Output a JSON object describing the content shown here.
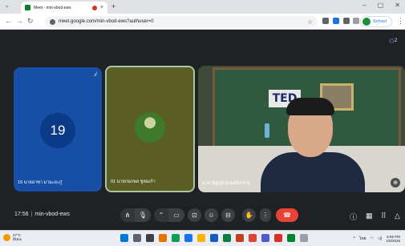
{
  "browser": {
    "tab_title": "Meet - min-vbod-ews",
    "tab_close": "×",
    "new_tab": "+",
    "url": "meet.google.com/min-vbod-ews?authuser=0",
    "profile_name": "School",
    "window_controls": [
      "–",
      "▢",
      "✕"
    ]
  },
  "meet": {
    "participant_count": "2",
    "tiles": [
      {
        "avatar_letter": "19",
        "name": "19 นายอาซา มามะยะกู๋"
      },
      {
        "name": "01 นายกนกพล ชูลมเก้า"
      },
      {
        "sign_text": "TED",
        "name": "นาย ณัฐภูมิ ศุภผลนิลชาน"
      }
    ],
    "meeting_time": "17:56",
    "meeting_code": "min-vbod-ews",
    "icons": {
      "people": "people-icon",
      "mic_off": "mic-off-icon",
      "pin": "pin-icon"
    }
  },
  "controls": {
    "buttons": [
      {
        "name": "audio-options-button",
        "glyph": "⋔"
      },
      {
        "name": "mic-button",
        "glyph": "🎙"
      },
      {
        "name": "video-options-button",
        "glyph": "⌃"
      },
      {
        "name": "camera-button",
        "glyph": "▭"
      },
      {
        "name": "present-button",
        "glyph": "⊡"
      },
      {
        "name": "emoji-button",
        "glyph": "☺"
      },
      {
        "name": "captions-button",
        "glyph": "⊟"
      },
      {
        "name": "raise-hand-button",
        "glyph": "✋"
      },
      {
        "name": "more-options-button",
        "glyph": "⋮"
      },
      {
        "name": "leave-call-button",
        "glyph": "☎"
      }
    ],
    "right": [
      "ⓘ",
      "▦",
      "⠿",
      "△"
    ]
  },
  "taskbar": {
    "weather_temp": "27°C",
    "weather_text": "มีเมฆ",
    "clock_time": "5:55 PM",
    "clock_date": "1/5/2026",
    "lang": "ไทย"
  },
  "colors": {
    "meet_bg": "#202124",
    "tile1_bg": "#174ea6",
    "end_call": "#ea4335",
    "active_speaker_border": "#a8c7a0"
  }
}
